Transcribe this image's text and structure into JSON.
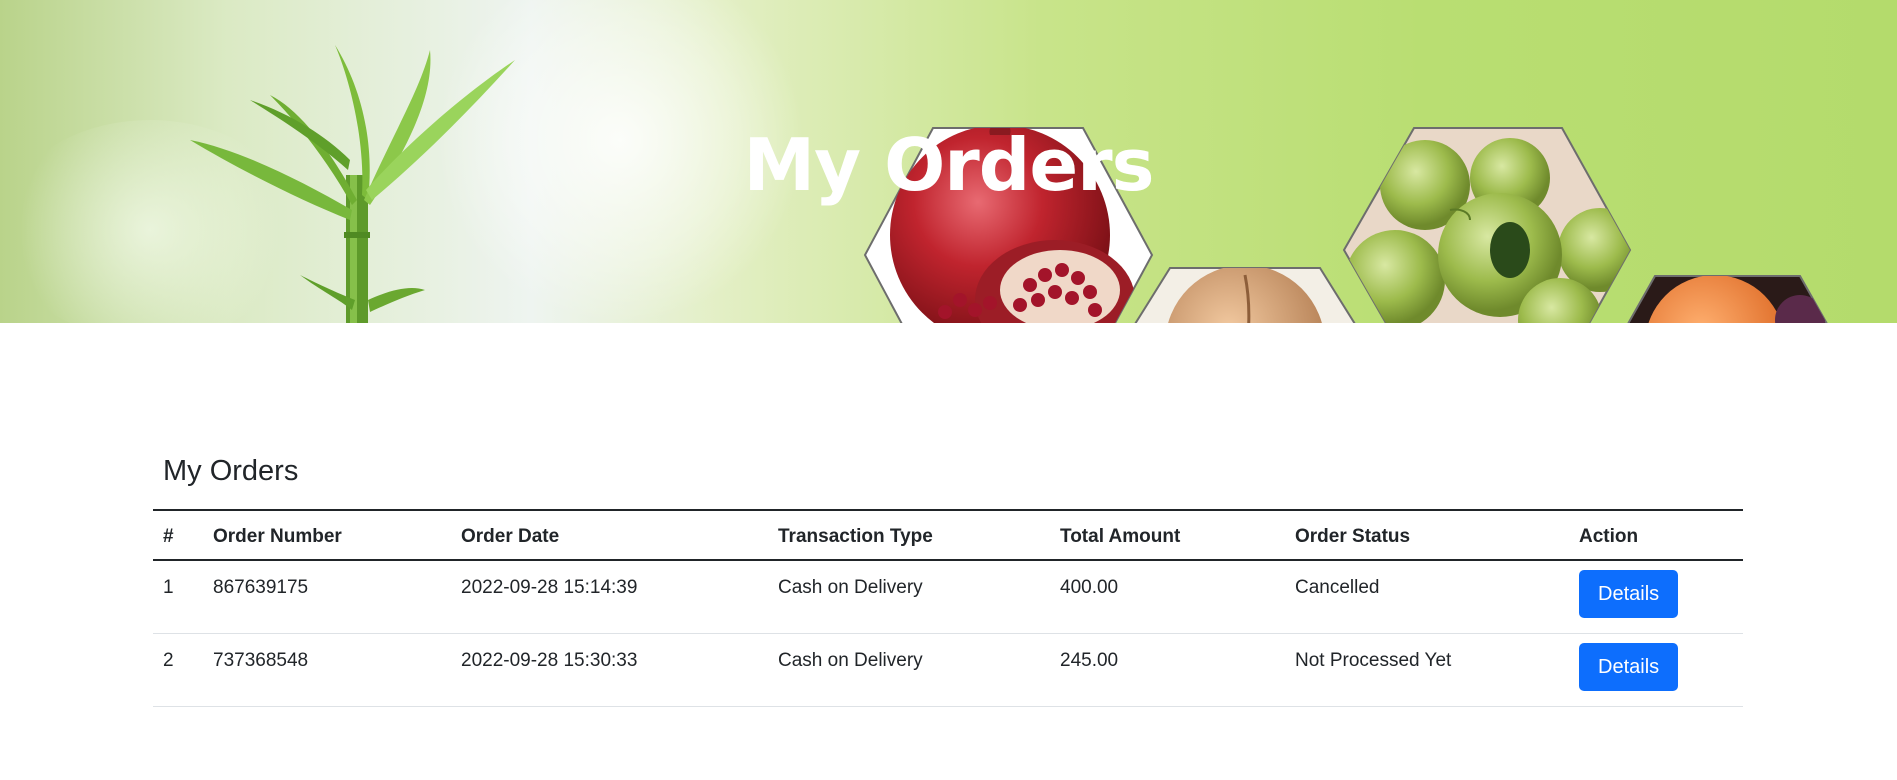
{
  "hero": {
    "title": "My Orders"
  },
  "orders": {
    "section_title": "My Orders",
    "columns": [
      "#",
      "Order Number",
      "Order Date",
      "Transaction Type",
      "Total Amount",
      "Order Status",
      "Action"
    ],
    "rows": [
      {
        "index": "1",
        "order_number": "867639175",
        "order_date": "2022-09-28 15:14:39",
        "transaction_type": "Cash on Delivery",
        "total_amount": "400.00",
        "status": "Cancelled",
        "action_label": "Details"
      },
      {
        "index": "2",
        "order_number": "737368548",
        "order_date": "2022-09-28 15:30:33",
        "transaction_type": "Cash on Delivery",
        "total_amount": "245.00",
        "status": "Not Processed Yet",
        "action_label": "Details"
      }
    ]
  },
  "colors": {
    "primary_button": "#0d6efd",
    "text": "#212529",
    "hero_green": "#b9de72"
  }
}
